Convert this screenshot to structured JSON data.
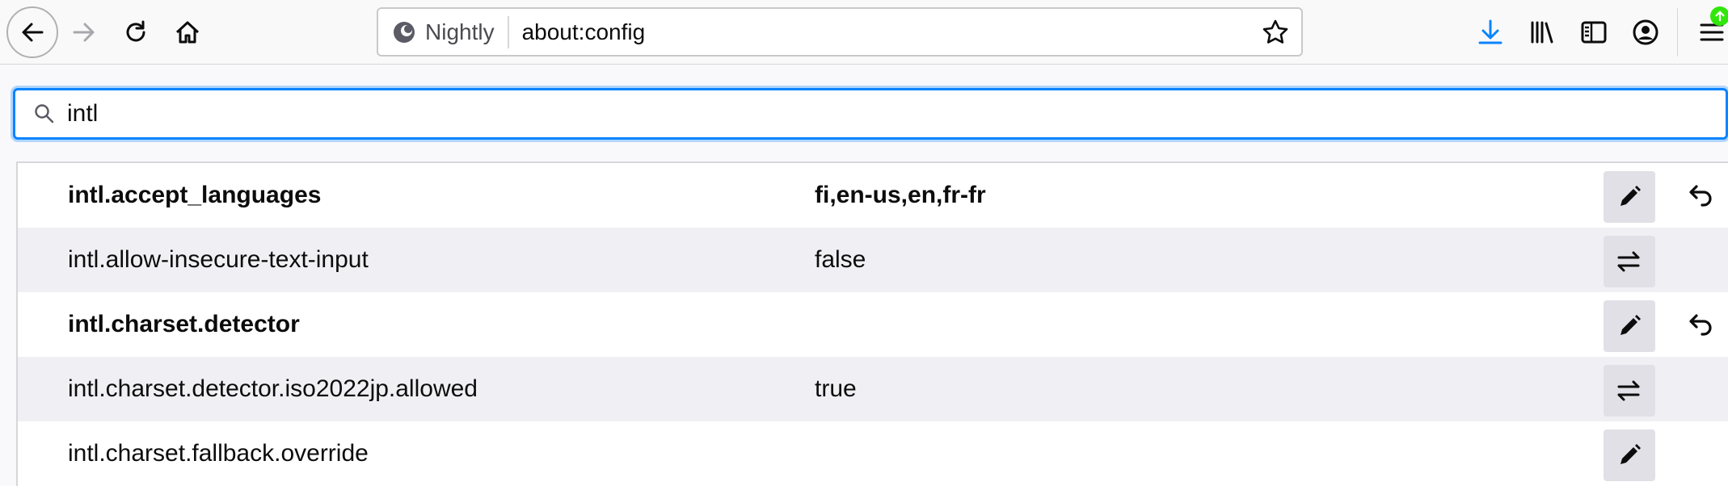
{
  "urlbar": {
    "identity_label": "Nightly",
    "url": "about:config"
  },
  "search": {
    "value": "intl"
  },
  "prefs": [
    {
      "name": "intl.accept_languages",
      "value": "fi,en-us,en,fr-fr",
      "modified": true,
      "type": "string"
    },
    {
      "name": "intl.allow-insecure-text-input",
      "value": "false",
      "modified": false,
      "type": "boolean"
    },
    {
      "name": "intl.charset.detector",
      "value": "",
      "modified": true,
      "type": "string"
    },
    {
      "name": "intl.charset.detector.iso2022jp.allowed",
      "value": "true",
      "modified": false,
      "type": "boolean"
    },
    {
      "name": "intl.charset.fallback.override",
      "value": "",
      "modified": false,
      "type": "string"
    }
  ],
  "colors": {
    "accent": "#0a84ff",
    "download": "#0a84ff",
    "update": "#30e60b"
  },
  "icons": {
    "back": "back-arrow-icon",
    "forward": "forward-arrow-icon",
    "reload": "reload-icon",
    "home": "home-icon",
    "identity": "firefox-nightly-icon",
    "bookmark": "star-icon",
    "downloads": "download-icon",
    "library": "library-icon",
    "sidebar": "sidebar-icon",
    "account": "account-icon",
    "menu": "hamburger-menu-icon",
    "search": "search-icon",
    "edit": "pencil-icon",
    "toggle": "toggle-arrows-icon",
    "reset": "undo-icon"
  }
}
